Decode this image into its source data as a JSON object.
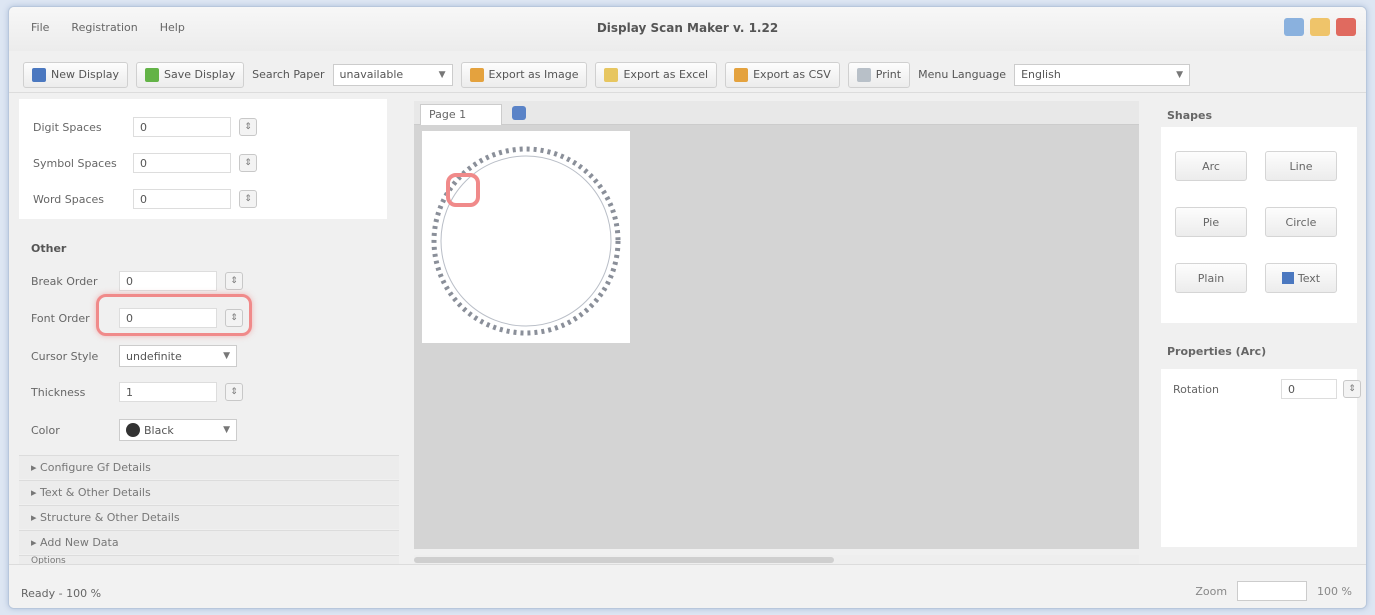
{
  "window": {
    "title": "Display Scan Maker v. 1.22",
    "menu": [
      "File",
      "Registration",
      "Help"
    ]
  },
  "toolbar": {
    "new_display": "New Display",
    "save_display": "Save Display",
    "search_paper_label": "Search Paper",
    "search_paper_value": "unavailable",
    "export_image": "Export as Image",
    "export_excel": "Export as Excel",
    "export_csv": "Export as CSV",
    "print": "Print",
    "menu_language_label": "Menu Language",
    "menu_language_value": "English"
  },
  "left_panel": {
    "spins": [
      {
        "label": "Digit Spaces",
        "value": "0"
      },
      {
        "label": "Symbol Spaces",
        "value": "0"
      },
      {
        "label": "Word Spaces",
        "value": "0"
      }
    ],
    "other_title": "Other",
    "other_rows": [
      {
        "label": "Break Order",
        "value": "0"
      },
      {
        "label": "Font Order",
        "value": "0"
      },
      {
        "label": "Cursor Style",
        "value": "undefinite"
      },
      {
        "label": "Thickness",
        "value": "1"
      },
      {
        "label": "Color",
        "value": "Black"
      }
    ],
    "collapsibles": [
      "Configure Gf Details",
      "Text & Other Details",
      "Structure & Other Details",
      "Add New Data",
      "Options"
    ]
  },
  "canvas": {
    "tab_label": "Page 1"
  },
  "right_panel": {
    "shapes_title": "Shapes",
    "shapes": [
      "Arc",
      "Line",
      "Pie",
      "Circle",
      "Plain",
      "Text"
    ],
    "properties_title": "Properties (Arc)",
    "rotation_label": "Rotation",
    "rotation_value": "0"
  },
  "status": {
    "text": "Ready - 100 %",
    "zoom_label": "Zoom",
    "zoom_value": "100 %"
  },
  "colors": {
    "highlight": "#f08a8a",
    "accent": "#4b78c0"
  }
}
